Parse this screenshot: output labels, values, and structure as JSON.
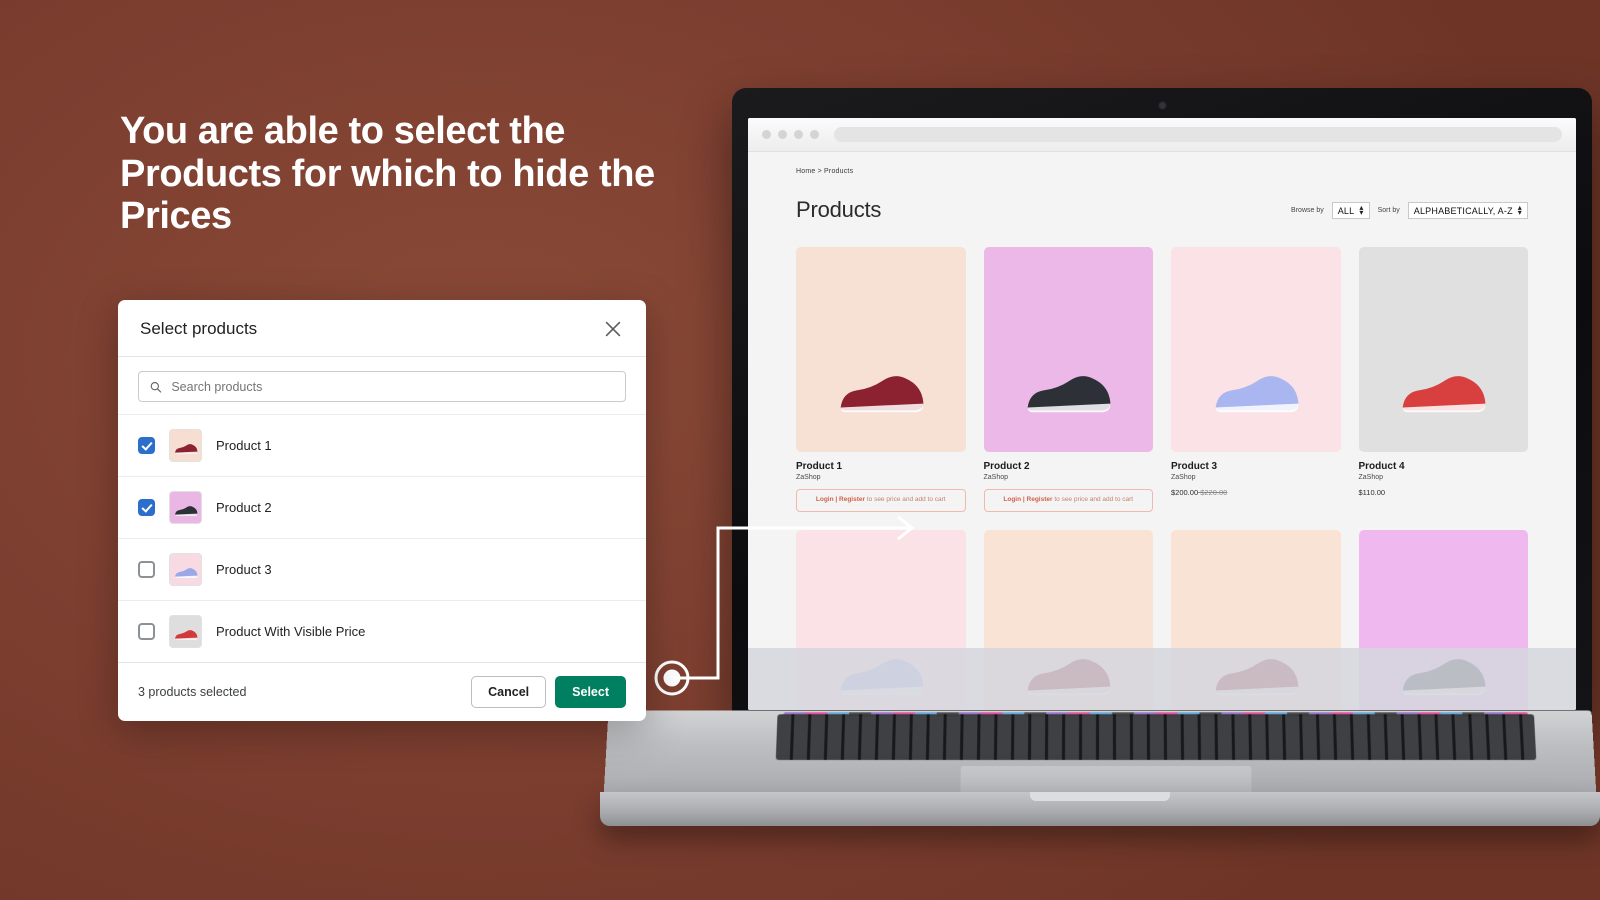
{
  "headline": "You are able to select the Products for which to hide the Prices",
  "theme": {
    "background": "#7d3f30",
    "accent_green": "#008060",
    "accent_blue": "#2c6ecb",
    "login_pink": "#d0614a"
  },
  "modal": {
    "title": "Select products",
    "close_icon": "close-icon",
    "search": {
      "icon": "search-icon",
      "placeholder": "Search products",
      "value": ""
    },
    "products": [
      {
        "name": "Product 1",
        "checked": true,
        "thumb_bg": "#f6ded2",
        "thumb_shoe": "#8c2130"
      },
      {
        "name": "Product 2",
        "checked": true,
        "thumb_bg": "#eab6e4",
        "thumb_shoe": "#2d3137"
      },
      {
        "name": "Product 3",
        "checked": false,
        "thumb_bg": "#f8dbe2",
        "thumb_shoe": "#9aa8e8"
      },
      {
        "name": "Product With Visible Price",
        "checked": false,
        "thumb_bg": "#dedede",
        "thumb_shoe": "#d03a3a"
      }
    ],
    "footer": {
      "count_label": "3 products selected",
      "cancel_label": "Cancel",
      "select_label": "Select"
    }
  },
  "browser": {
    "window_dots": 4,
    "url_value": "",
    "store": {
      "breadcrumb": "Home > Products",
      "page_title": "Products",
      "browse_by_label": "Browse by",
      "browse_by_value": "ALL",
      "sort_by_label": "Sort by",
      "sort_by_value": "ALPHABETICALLY, A-Z",
      "products": [
        {
          "name": "Product 1",
          "vendor": "ZaShop",
          "price_hidden": true,
          "price": "",
          "compare_at": "",
          "login_prefix": "Login | Register",
          "login_suffix": " to see price and add to cart",
          "bg": "#f7e0d4",
          "shoe": "#8c2130"
        },
        {
          "name": "Product 2",
          "vendor": "ZaShop",
          "price_hidden": true,
          "price": "",
          "compare_at": "",
          "login_prefix": "Login | Register",
          "login_suffix": " to see price and add to cart",
          "bg": "#ecb8e8",
          "shoe": "#2d3137"
        },
        {
          "name": "Product 3",
          "vendor": "ZaShop",
          "price_hidden": false,
          "price": "$200.00",
          "compare_at": "$220.00",
          "login_prefix": "",
          "login_suffix": "",
          "bg": "#fbe2e6",
          "shoe": "#a9b6f0"
        },
        {
          "name": "Product 4",
          "vendor": "ZaShop",
          "price_hidden": false,
          "price": "$110.00",
          "compare_at": "",
          "login_prefix": "",
          "login_suffix": "",
          "bg": "#e0e0e0",
          "shoe": "#d84040"
        }
      ],
      "row2_tiles": [
        "#fbe2e6",
        "#f9e3d5",
        "#f9e3d5",
        "#efb9ef"
      ]
    }
  },
  "callout": {
    "marker_icon": "callout-dot-icon",
    "arrow_icon": "arrow-right-icon"
  }
}
